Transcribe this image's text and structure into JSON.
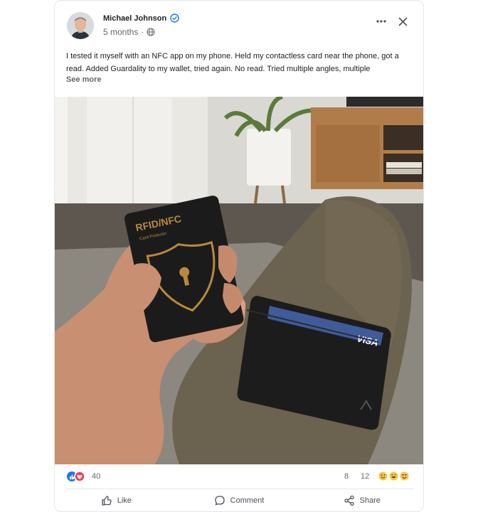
{
  "post": {
    "author": "Michael Johnson",
    "time": "5 months",
    "separator": "·",
    "text": "I tested it myself with an NFC app on my phone. Held my contactless card near the phone, got a read. Added Guardality to my wallet, tried again. No read. Tried multiple angles, multiple",
    "see_more": "See more"
  },
  "photo": {
    "card_title": "RFID/NFC",
    "card_subtitle": "Card Protector",
    "visa_label": "VISA"
  },
  "stats": {
    "reactions": "40",
    "comments": "8",
    "shares": "12"
  },
  "actions": {
    "like": "Like",
    "comment": "Comment",
    "share": "Share"
  },
  "colors": {
    "verified": "#1877f2",
    "like_blue": "#1877f2",
    "love_red": "#f33e58",
    "card_gold": "#b88a3a"
  },
  "icons": [
    "verified-icon",
    "globe-icon",
    "more-icon",
    "close-icon",
    "like-icon",
    "comment-icon",
    "share-icon"
  ]
}
